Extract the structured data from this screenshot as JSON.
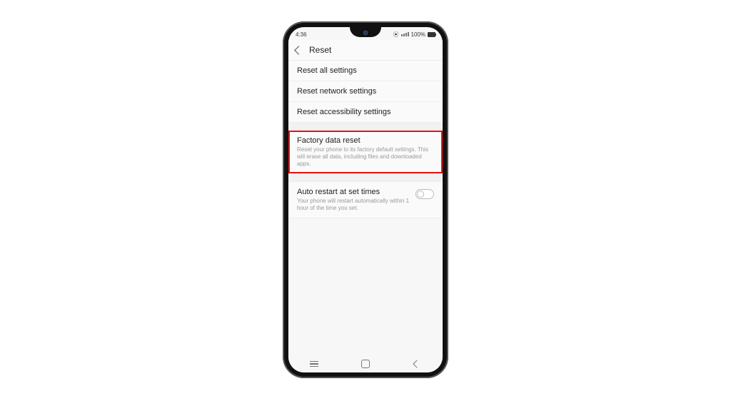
{
  "status": {
    "time": "4:36",
    "battery_text": "100%"
  },
  "header": {
    "title": "Reset"
  },
  "rows": {
    "reset_all": "Reset all settings",
    "reset_network": "Reset network settings",
    "reset_accessibility": "Reset accessibility settings",
    "factory_title": "Factory data reset",
    "factory_sub": "Reset your phone to its factory default settings. This will erase all data, including files and downloaded apps.",
    "auto_title": "Auto restart at set times",
    "auto_sub": "Your phone will restart automatically within 1 hour of the time you set."
  }
}
